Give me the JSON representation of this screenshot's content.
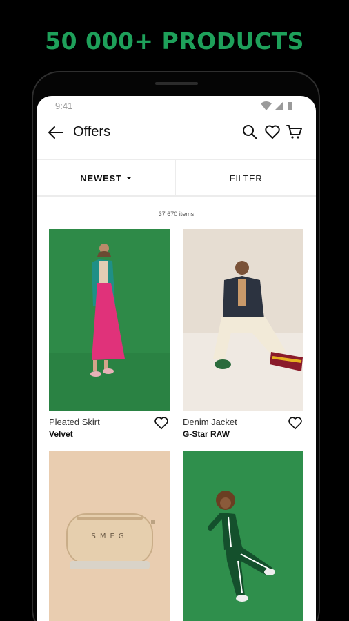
{
  "promo": {
    "headline": "50 000+ PRODUCTS"
  },
  "status_bar": {
    "time": "9:41"
  },
  "app_bar": {
    "title": "Offers"
  },
  "toolbar": {
    "sort_label": "NEWEST",
    "filter_label": "FILTER"
  },
  "results": {
    "count_label": "37 670 items"
  },
  "products": [
    {
      "name": "Pleated Skirt",
      "brand": "Velvet"
    },
    {
      "name": "Denim Jacket",
      "brand": "G-Star RAW"
    },
    {
      "name": "",
      "brand": ""
    },
    {
      "name": "",
      "brand": ""
    }
  ],
  "colors": {
    "brand_green": "#1ea05a",
    "photo_green": "#2f8a4a",
    "photo_beige": "#e4d9cc",
    "photo_peach": "#e8c9a8"
  },
  "icons": [
    "back-arrow-icon",
    "search-icon",
    "heart-icon",
    "cart-icon",
    "wifi-icon",
    "signal-icon",
    "battery-icon",
    "caret-down-icon"
  ]
}
